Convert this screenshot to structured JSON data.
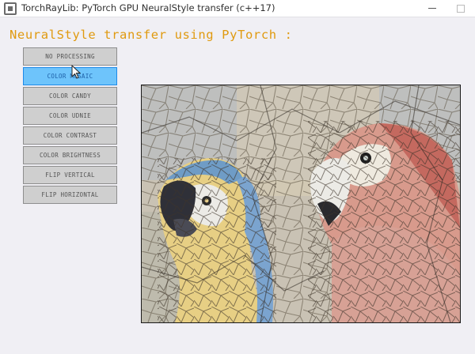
{
  "window": {
    "title": "TorchRayLib: PyTorch GPU NeuralStyle transfer (c++17)",
    "minimize_glyph": "—",
    "maximize_glyph": "□"
  },
  "heading": "NeuralStyle transfer using PyTorch :",
  "menu": {
    "active_index": 1,
    "items": [
      {
        "label": "NO PROCESSING"
      },
      {
        "label": "COLOR MOSAIC"
      },
      {
        "label": "COLOR CANDY"
      },
      {
        "label": "COLOR UDNIE"
      },
      {
        "label": "COLOR CONTRAST"
      },
      {
        "label": "COLOR BRIGHTNESS"
      },
      {
        "label": "FLIP VERTICAL"
      },
      {
        "label": "FLIP HORIZONTAL"
      }
    ]
  },
  "colors": {
    "heading": "#e09a10",
    "active_button": "#6ec4fb",
    "active_border": "#1d8ae8",
    "button": "#cfcfcf",
    "background": "#f0eff4"
  },
  "image": {
    "description_icon": "mosaic-parrots-image"
  }
}
